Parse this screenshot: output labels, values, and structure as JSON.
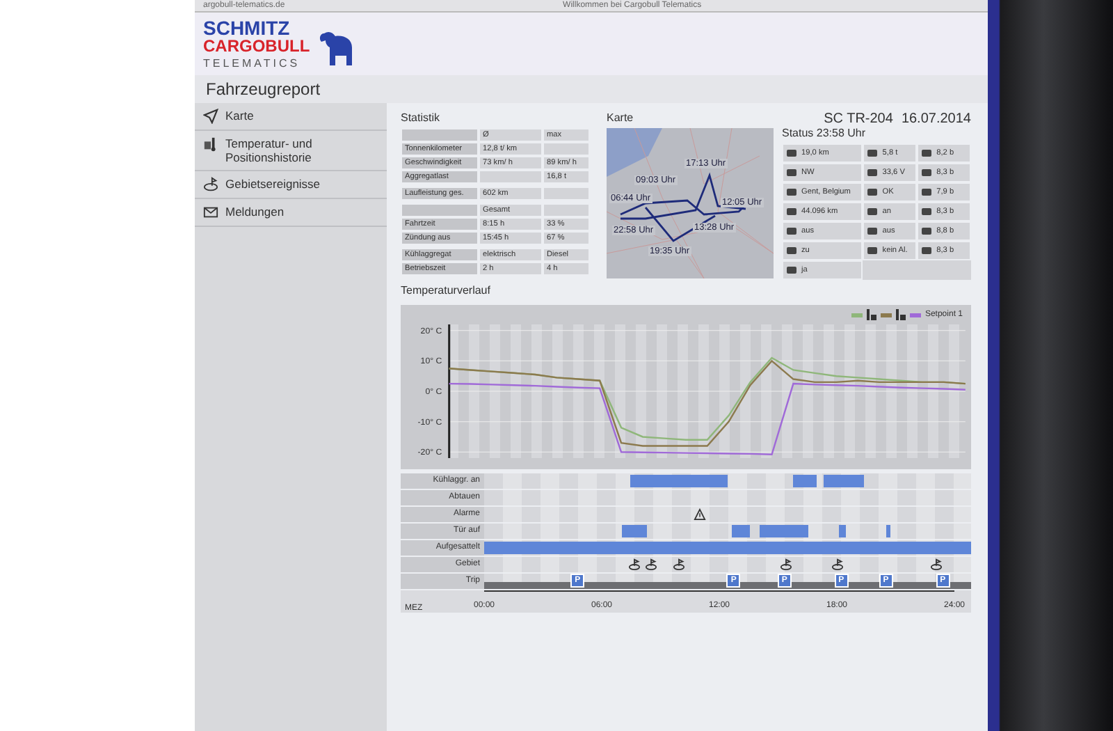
{
  "browser": {
    "url": "argobull-telematics.de",
    "title": "Willkommen bei Cargobull Telematics"
  },
  "logo": {
    "line_1": "SCHMITZ",
    "line_2": "CARGOBULL",
    "line_3": "TELEMATICS"
  },
  "page_title": "Fahrzeugreport",
  "sidebar": {
    "items": [
      {
        "label": "Karte",
        "kind": "map"
      },
      {
        "label": "Temperatur- und Positionshistorie",
        "kind": "temperature"
      },
      {
        "label": "Gebietsereignisse",
        "kind": "area"
      },
      {
        "label": "Meldungen",
        "kind": "mail"
      }
    ]
  },
  "statistics": {
    "title": "Statistik",
    "sections": [
      {
        "rows": [
          [
            null,
            "Ø",
            "max"
          ],
          [
            "Tonnenkilometer",
            "12,8 t/ km",
            null
          ],
          [
            "Geschwindigkeit",
            "73 km/ h",
            "89 km/ h"
          ],
          [
            "Aggregatlast",
            null,
            "16,8 t"
          ]
        ]
      },
      {
        "rows": [
          [
            "Laufleistung ges.",
            "602 km",
            null
          ]
        ]
      },
      {
        "rows": [
          [
            null,
            "Gesamt",
            null
          ],
          [
            "Fahrtzeit",
            "8:15 h",
            "33 %"
          ],
          [
            "Zündung aus",
            "15:45 h",
            "67 %"
          ]
        ]
      },
      {
        "rows": [
          [
            "Kühlaggregat",
            "elektrisch",
            "Diesel"
          ],
          [
            "Betriebszeit",
            "2 h",
            "4 h"
          ]
        ]
      }
    ]
  },
  "map": {
    "title": "Karte",
    "labels": [
      "09:03 Uhr",
      "06:44 Uhr",
      "22:58 Uhr",
      "19:35 Uhr",
      "17:13 Uhr",
      "13:28 Uhr",
      "12:05 Uhr"
    ]
  },
  "vehicle": {
    "id": "SC TR-204",
    "date": "16.07.2014"
  },
  "status": {
    "title": "Status 23:58 Uhr",
    "columns": [
      [
        "19,0 km",
        "NW",
        "Gent, Belgium",
        "44.096 km",
        "aus",
        "zu",
        "ja"
      ],
      [
        "5,8 t",
        "33,6 V",
        "OK",
        "an",
        "aus",
        "kein Al."
      ],
      [
        "8,2 b",
        "8,3 b",
        "7,9 b",
        "8,3 b",
        "8,8 b",
        "8,3 b"
      ]
    ]
  },
  "temperature": {
    "title": "Temperaturverlauf",
    "chart_data": {
      "type": "line",
      "grid": true,
      "ylim": [
        -22,
        22
      ],
      "yticks": [
        {
          "value": 20,
          "label": "20° C"
        },
        {
          "value": 10,
          "label": "10° C"
        },
        {
          "value": 0,
          "label": "0° C"
        },
        {
          "value": -10,
          "label": "-10° C"
        },
        {
          "value": -20,
          "label": "-20° C"
        }
      ],
      "series": [
        {
          "color": "#8fb77a",
          "values": [
            7.5,
            7,
            6.5,
            6,
            5.5,
            4.5,
            4,
            3.5,
            -12,
            -15,
            -15.5,
            -16,
            -16,
            -8,
            3,
            11,
            7,
            6,
            5,
            4.5,
            4,
            3.5,
            3,
            3,
            2.5
          ]
        },
        {
          "color": "#8c7a4e",
          "values": [
            7.5,
            7,
            6.5,
            6,
            5.5,
            4.5,
            4,
            3.5,
            -17,
            -18,
            -18,
            -18,
            -18,
            -10,
            2,
            10,
            4,
            3,
            3,
            3.5,
            3,
            3,
            3,
            3,
            2.5
          ]
        },
        {
          "name": "Setpoint 1",
          "color": "#a06ad8",
          "values": [
            2.5,
            2.4,
            2.2,
            2,
            1.8,
            1.5,
            1.2,
            1,
            -20,
            -20.1,
            -20.2,
            -20.3,
            -20.4,
            -20.5,
            -20.6,
            -20.8,
            2.5,
            2.2,
            2,
            1.8,
            1.5,
            1.2,
            1,
            0.8,
            0.5
          ]
        }
      ]
    }
  },
  "timeline": {
    "zone": "MEZ",
    "ticks": [
      "00:00",
      "06:00",
      "12:00",
      "18:00",
      "24:00"
    ],
    "rows": [
      {
        "label": "Kühlaggr. an",
        "kind": "bars"
      },
      {
        "label": "Abtauen",
        "kind": "bars"
      },
      {
        "label": "Alarme",
        "kind": "alarm"
      },
      {
        "label": "Tür auf",
        "kind": "bars"
      },
      {
        "label": "Aufgesattelt",
        "kind": "bars"
      },
      {
        "label": "Gebiet",
        "kind": "area"
      },
      {
        "label": "Trip",
        "kind": "trip",
        "markers": [
          "P",
          "P",
          "P",
          "P",
          "P",
          "P"
        ]
      }
    ]
  }
}
